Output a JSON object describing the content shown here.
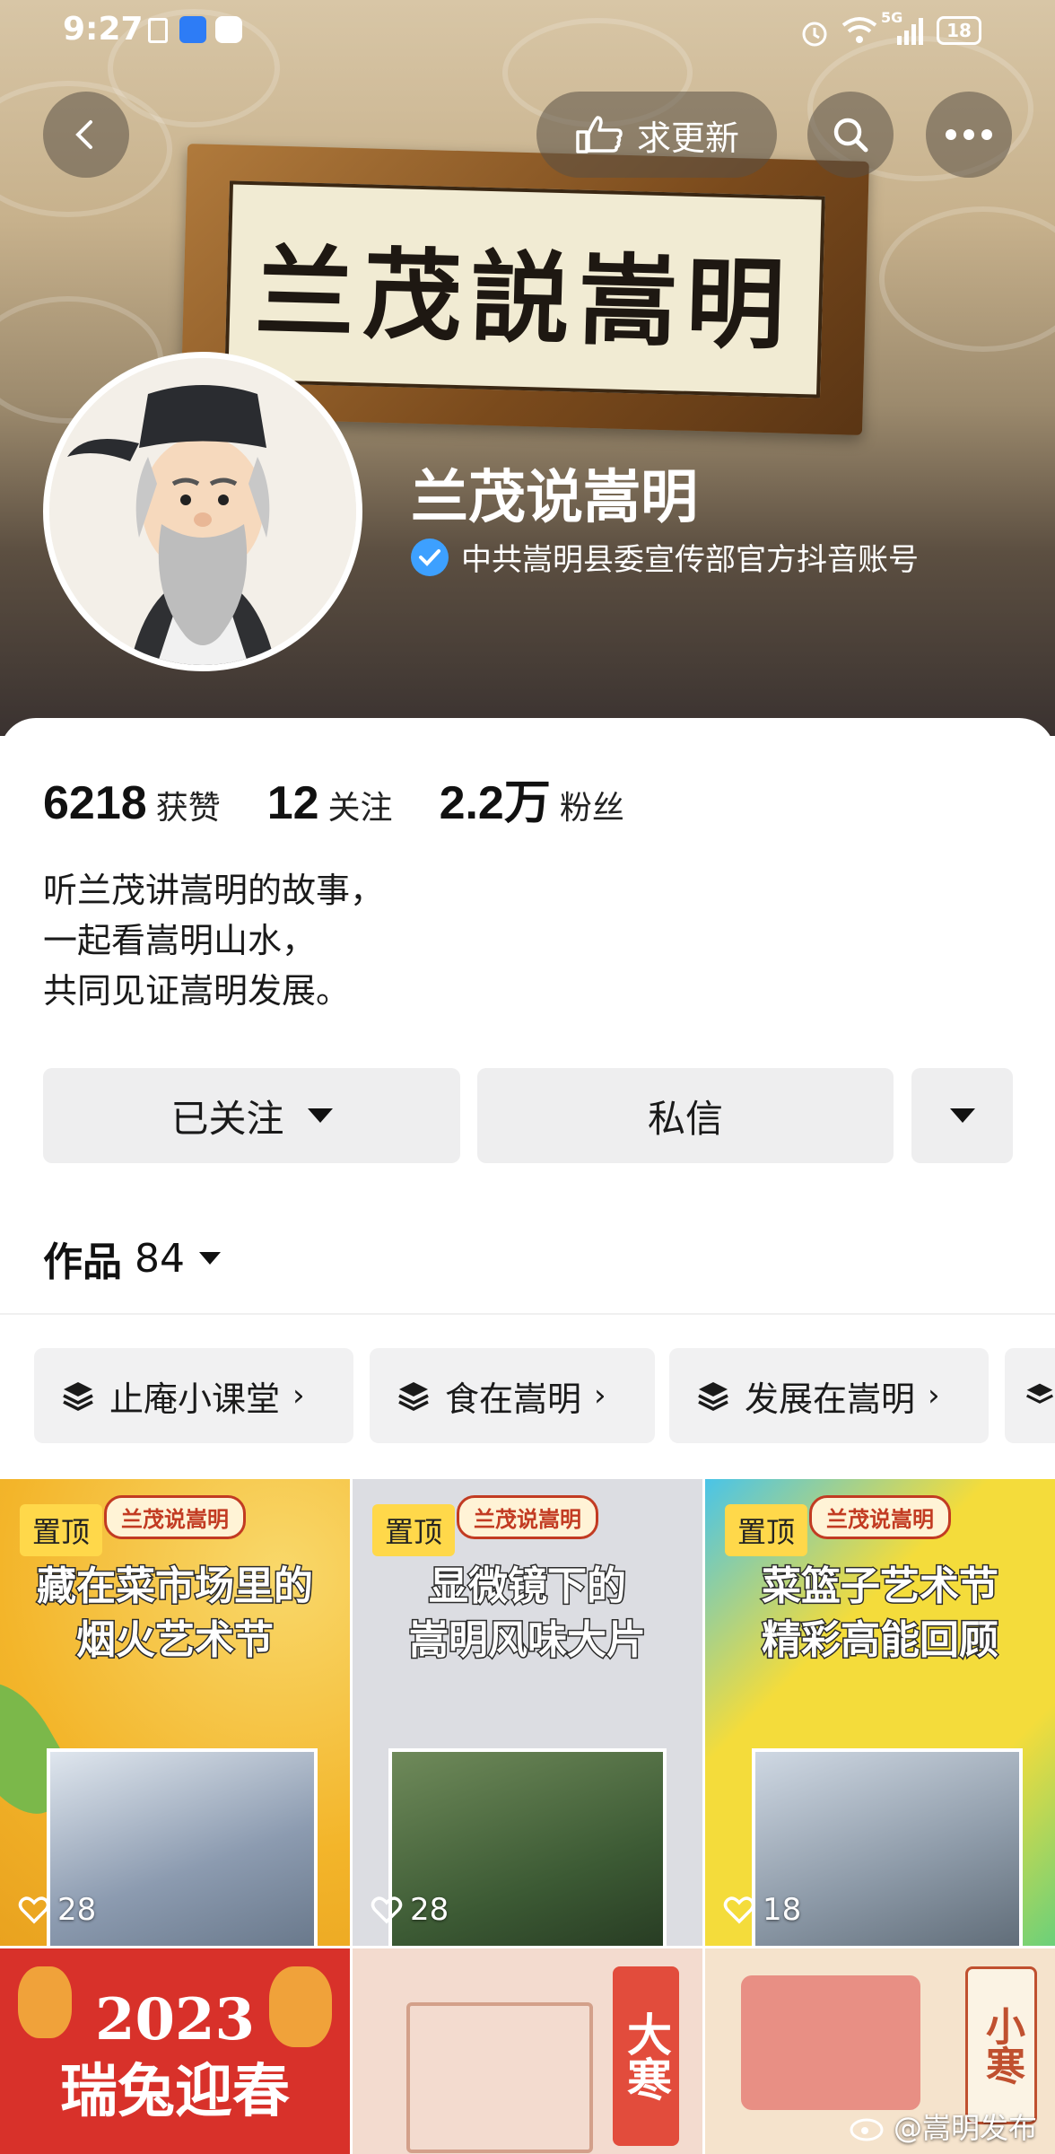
{
  "status_bar": {
    "time": "9:27",
    "battery": "18",
    "network": "5G"
  },
  "header": {
    "request_update_label": "求更新",
    "plaque_text": "兰茂説嵩明",
    "profile_name": "兰茂说嵩明",
    "verified_text": "中共嵩明县委宣传部官方抖音账号"
  },
  "stats": [
    {
      "value": "6218",
      "label": "获赞"
    },
    {
      "value": "12",
      "label": "关注"
    },
    {
      "value": "2.2万",
      "label": "粉丝"
    }
  ],
  "bio": [
    "听兰茂讲嵩明的故事，",
    "一起看嵩明山水，",
    "共同见证嵩明发展。"
  ],
  "actions": {
    "follow_label": "已关注",
    "message_label": "私信"
  },
  "works": {
    "label": "作品",
    "count": "84"
  },
  "collections": [
    "止庵小课堂",
    "食在嵩明",
    "发展在嵩明"
  ],
  "videos": [
    {
      "pin": "置顶",
      "brand": "兰茂说嵩明",
      "title": "藏在菜市场里的\n烟火艺术节",
      "likes": "28",
      "bg": "#f6c23a"
    },
    {
      "pin": "置顶",
      "brand": "兰茂说嵩明",
      "title": "显微镜下的\n嵩明风味大片",
      "likes": "28",
      "bg": "#d9dbe0"
    },
    {
      "pin": "置顶",
      "brand": "兰茂说嵩明",
      "title": "菜篮子艺术节\n精彩高能回顾",
      "likes": "18",
      "bg": "#f4dc3b"
    },
    {
      "title": "2023\n瑞兔迎春",
      "bg": "#d8312a"
    },
    {
      "title": "大寒",
      "bg": "#f3dbcf"
    },
    {
      "title": "小寒",
      "bg": "#f5e3cc"
    }
  ],
  "watermark": "@嵩明发布",
  "colors": {
    "accent": "#3da0ff",
    "pin": "#ffd84a",
    "button_bg": "#eeeeef"
  }
}
